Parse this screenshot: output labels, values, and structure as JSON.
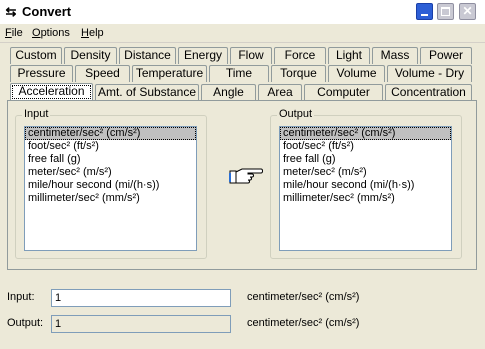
{
  "window": {
    "title": "Convert",
    "icon": "convert-arrows-icon"
  },
  "menu": [
    {
      "label": "File",
      "accel": "F",
      "rest": "ile"
    },
    {
      "label": "Options",
      "accel": "O",
      "rest": "ptions"
    },
    {
      "label": "Help",
      "accel": "H",
      "rest": "elp"
    }
  ],
  "tabs": {
    "row1": [
      "Custom",
      "Density",
      "Distance",
      "Energy",
      "Flow",
      "Force",
      "Light",
      "Mass",
      "Power"
    ],
    "row2": [
      "Pressure",
      "Speed",
      "Temperature",
      "Time",
      "Torque",
      "Volume",
      "Volume - Dry"
    ],
    "row3": [
      "Acceleration",
      "Amt. of Substance",
      "Angle",
      "Area",
      "Computer",
      "Concentration"
    ],
    "active": "Acceleration"
  },
  "input_group": {
    "label": "Input",
    "items": [
      "centimeter/sec² (cm/s²)",
      "foot/sec² (ft/s²)",
      "free fall (g)",
      "meter/sec² (m/s²)",
      "mile/hour second (mi/(h·s))",
      "millimeter/sec² (mm/s²)"
    ],
    "selected_index": 0
  },
  "output_group": {
    "label": "Output",
    "items": [
      "centimeter/sec² (cm/s²)",
      "foot/sec² (ft/s²)",
      "free fall (g)",
      "meter/sec² (m/s²)",
      "mile/hour second (mi/(h·s))",
      "millimeter/sec² (mm/s²)"
    ],
    "selected_index": 0
  },
  "convert_icon": "pointing-hand-icon",
  "input_field": {
    "label": "Input:",
    "value": "1",
    "unit": "centimeter/sec² (cm/s²)"
  },
  "output_field": {
    "label": "Output:",
    "value": "1",
    "unit": "centimeter/sec² (cm/s²)"
  }
}
